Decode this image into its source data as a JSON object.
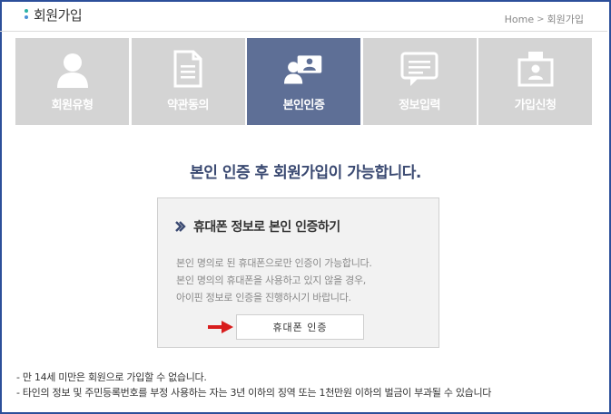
{
  "header": {
    "title": "회원가입",
    "breadcrumb": {
      "home": "Home",
      "current": "회원가입",
      "separator": ">"
    }
  },
  "steps": [
    {
      "label": "회원유형",
      "icon": "user-icon",
      "active": false
    },
    {
      "label": "약관동의",
      "icon": "document-icon",
      "active": false
    },
    {
      "label": "본인인증",
      "icon": "id-card-person-icon",
      "active": true
    },
    {
      "label": "정보입력",
      "icon": "message-form-icon",
      "active": false
    },
    {
      "label": "가입신청",
      "icon": "registration-card-icon",
      "active": false
    }
  ],
  "main": {
    "message": "본인 인증 후 회원가입이 가능합니다."
  },
  "verify_box": {
    "title": "휴대폰 정보로 본인 인증하기",
    "desc": [
      "본인 명의로 된 휴대폰으로만 인증이 가능합니다.",
      "본인 명의의 휴대폰을 사용하고 있지 않을 경우,",
      "아이핀 정보로 인증을 진행하시기 바랍니다."
    ],
    "button_label": "휴대폰 인증"
  },
  "notices": [
    "- 만 14세 미만은 회원으로 가입할 수 없습니다.",
    "- 타인의 정보 및 주민등록번호를 부정 사용하는 자는 3년 이하의 징역 또는 1천만원 이하의 벌금이 부과될 수 있습니다"
  ],
  "colors": {
    "frame_border": "#2c4f9a",
    "step_inactive": "#d4d4d4",
    "step_active": "#5e6f96",
    "message_text": "#3b4a72",
    "arrow_red": "#d81d1d"
  }
}
